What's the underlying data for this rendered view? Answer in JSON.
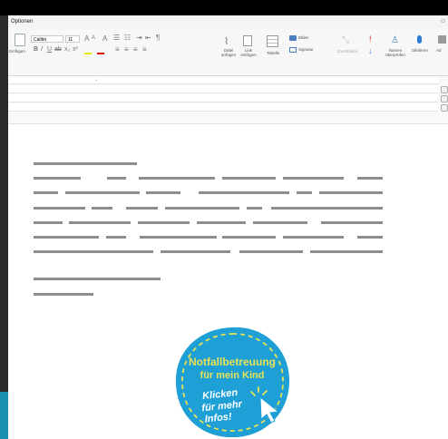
{
  "ribbon": {
    "tab_label": "Optionen",
    "font_name": "Calibri",
    "font_size": "11",
    "paste_label": "Einfügen",
    "attach_file_label": "Datei\nanfügen",
    "link_label": "Link\neinfügen",
    "table_label": "Tabelle",
    "pictures_label": "Bilder",
    "signature_label": "Signatur",
    "zoom_label": "Zoomfaktor",
    "check_names_label": "Namen\nüberprüfen",
    "dictate_label": "Diktieren",
    "more_label": "Ad"
  },
  "badge": {
    "title_line1": "Notfallbetreuung",
    "title_line2": "für mein Kind",
    "cta_line1": "Klicken",
    "cta_line2": "für mehr",
    "cta_line3": "Infos!",
    "fill_color": "#1e9fd6",
    "accent_color": "#e8e255"
  }
}
